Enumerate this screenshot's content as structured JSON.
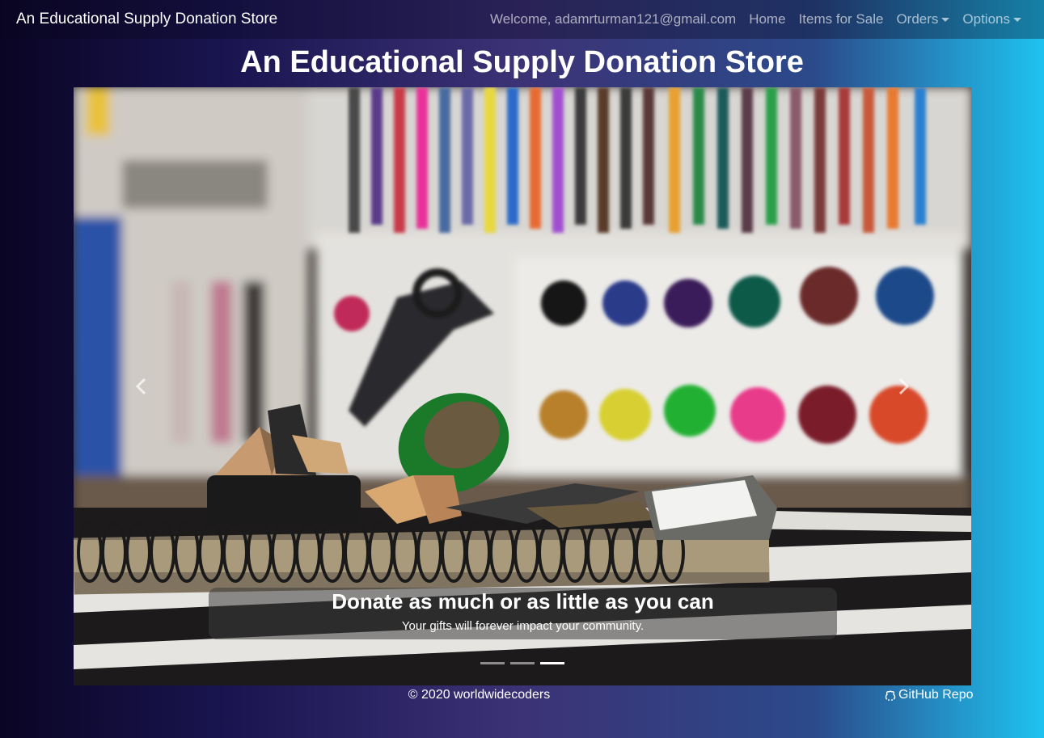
{
  "navbar": {
    "brand": "An Educational Supply Donation Store",
    "welcome": "Welcome, adamrturman121@gmail.com",
    "home": "Home",
    "items": "Items for Sale",
    "orders": "Orders",
    "options": "Options"
  },
  "page_title": "An Educational Supply Donation Store",
  "carousel": {
    "caption_title": "Donate as much or as little as you can",
    "caption_text": "Your gifts will forever impact your community.",
    "prev_icon": "chevron-left-icon",
    "next_icon": "chevron-right-icon",
    "slide_count": 3,
    "active_slide": 3
  },
  "footer": {
    "copyright": "© 2020 worldwidecoders",
    "repo": "GitHub Repo",
    "repo_icon": "github-icon"
  }
}
